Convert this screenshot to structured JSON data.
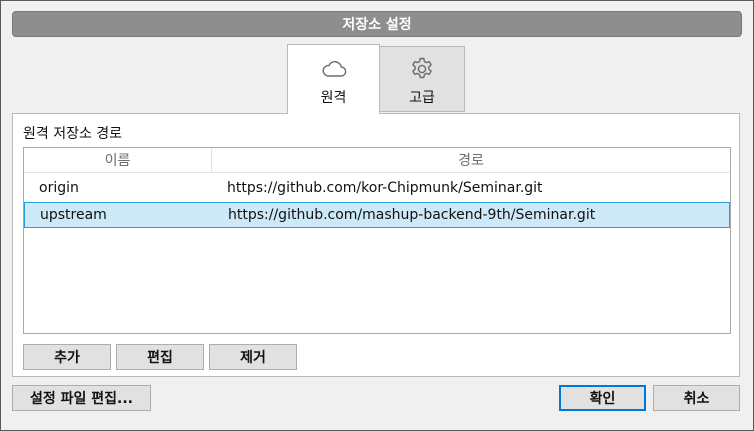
{
  "window": {
    "title": "저장소 설정"
  },
  "tabs": [
    {
      "label": "원격",
      "icon": "cloud-icon",
      "active": true
    },
    {
      "label": "고급",
      "icon": "gear-icon",
      "active": false
    }
  ],
  "remote": {
    "section_title": "원격 저장소 경로",
    "columns": [
      "이름",
      "경로"
    ],
    "rows": [
      {
        "name": "origin",
        "url": "https://github.com/kor-Chipmunk/Seminar.git",
        "selected": false
      },
      {
        "name": "upstream",
        "url": "https://github.com/mashup-backend-9th/Seminar.git",
        "selected": true
      }
    ],
    "buttons": {
      "add": "추가",
      "edit": "편집",
      "remove": "제거"
    }
  },
  "footer": {
    "edit_config": "설정 파일 편집...",
    "ok": "확인",
    "cancel": "취소"
  },
  "colors": {
    "titlebar": "#8e8e8e",
    "selection_bg": "#cde8f7",
    "selection_border": "#26a0da",
    "primary_border": "#0078d7"
  }
}
